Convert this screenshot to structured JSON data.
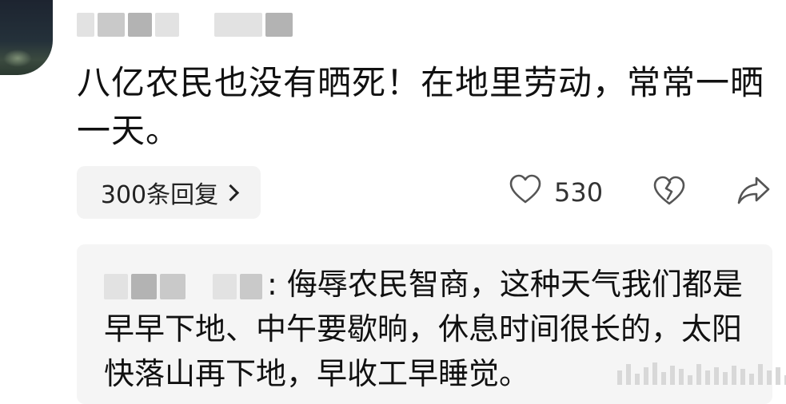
{
  "comment": {
    "avatar_icon": "user-avatar",
    "username_blurred": true,
    "text": "八亿农民也没有晒死！在地里劳动，常常一晒一天。",
    "replies_label": "300条回复",
    "replies_chevron_icon": "chevron-right-icon",
    "like_icon": "heart-outline-icon",
    "like_count": "530",
    "dislike_icon": "broken-heart-icon",
    "share_icon": "share-arrow-icon"
  },
  "reply": {
    "username_blurred": true,
    "separator": ":",
    "text": " 侮辱农民智商，这种天气我们都是早早下地、中午要歇晌，休息时间很长的，太阳快落山再下地，早收工早睡觉。"
  },
  "colors": {
    "background": "#ffffff",
    "reply_box": "#f5f5f5",
    "replies_button": "#f3f3f3",
    "text": "#111111",
    "icon": "#555555"
  }
}
